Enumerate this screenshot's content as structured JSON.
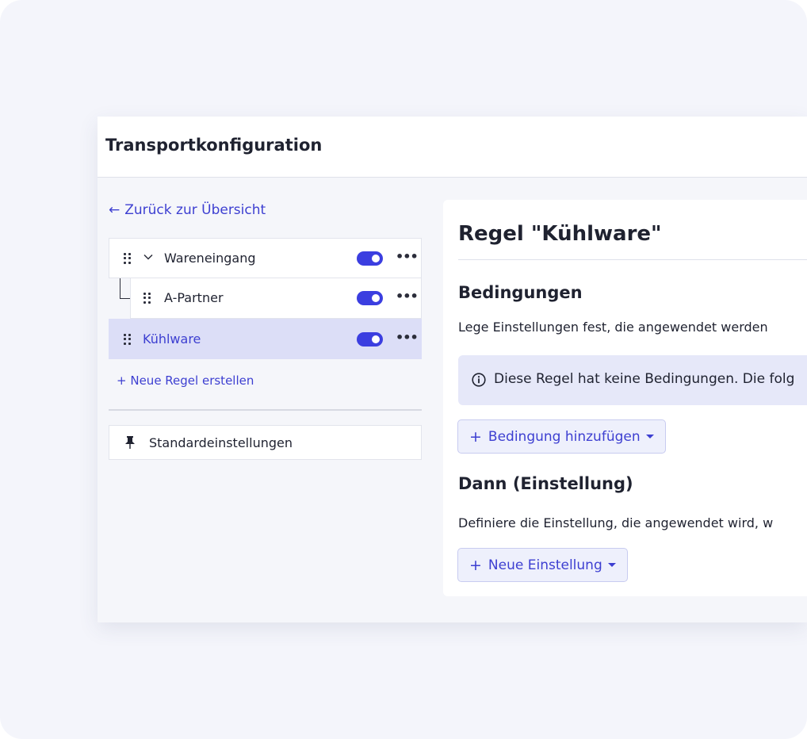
{
  "header": {
    "title": "Transportkonfiguration"
  },
  "nav": {
    "back_arrow": "←",
    "back_label": "Zurück zur Übersicht"
  },
  "rules": [
    {
      "label": "Wareneingang",
      "enabled": true,
      "expanded": true,
      "selected": false
    },
    {
      "label": "A-Partner",
      "enabled": true,
      "expanded": false,
      "selected": false
    },
    {
      "label": "Kühlware",
      "enabled": true,
      "expanded": false,
      "selected": true
    }
  ],
  "more_glyph": "•••",
  "new_rule": {
    "icon": "+",
    "label": "Neue Regel erstellen"
  },
  "defaults": {
    "label": "Standardeinstellungen"
  },
  "detail": {
    "title": "Regel \"Kühlware\"",
    "conditions": {
      "heading": "Bedingungen",
      "description": "Lege Einstellungen fest, die angewendet werden",
      "info": "Diese Regel hat keine Bedingungen. Die folg",
      "add_button": "Bedingung hinzufügen"
    },
    "then": {
      "heading": "Dann (Einstellung)",
      "description": "Definiere die Einstellung, die angewendet wird, w",
      "add_button": "Neue Einstellung"
    },
    "button_plus": "+"
  },
  "colors": {
    "accent": "#3d3fd1",
    "toggle_on": "#3b3ee0",
    "selected_row": "#dcdef7",
    "info_bg": "#e6e8f9"
  }
}
